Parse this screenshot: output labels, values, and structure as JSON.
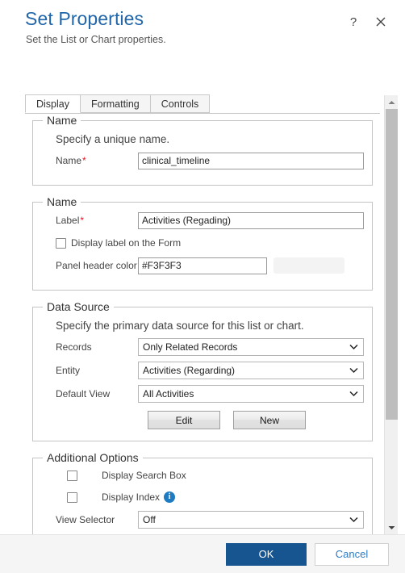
{
  "dialog": {
    "title": "Set Properties",
    "subtitle": "Set the List or Chart properties.",
    "help_icon": "help-question-icon",
    "close_icon": "close-x-icon"
  },
  "tabs": [
    {
      "label": "Display",
      "active": true
    },
    {
      "label": "Formatting",
      "active": false
    },
    {
      "label": "Controls",
      "active": false
    }
  ],
  "groups": {
    "name_group": {
      "legend": "Name",
      "description": "Specify a unique name.",
      "name_label": "Name",
      "name_required": "*",
      "name_value": "clinical_timeline"
    },
    "label_group": {
      "legend": "Name",
      "label_label": "Label",
      "label_required": "*",
      "label_value": "Activities (Regading)",
      "display_label_checkbox": "Display label on the Form",
      "display_label_checked": false,
      "panel_header_color_label": "Panel header color",
      "panel_header_color_value": "#F3F3F3",
      "panel_header_color_swatch": "#F3F3F3"
    },
    "data_source": {
      "legend": "Data Source",
      "description": "Specify the primary data source for this list or chart.",
      "records_label": "Records",
      "records_value": "Only Related Records",
      "entity_label": "Entity",
      "entity_value": "Activities (Regarding)",
      "default_view_label": "Default View",
      "default_view_value": "All Activities",
      "edit_button": "Edit",
      "new_button": "New"
    },
    "additional_options": {
      "legend": "Additional Options",
      "display_search_box_label": "Display Search Box",
      "display_search_box_checked": false,
      "display_index_label": "Display Index",
      "display_index_checked": false,
      "display_index_info_icon": "info-icon",
      "view_selector_label": "View Selector",
      "view_selector_value": "Off"
    }
  },
  "footer": {
    "ok_label": "OK",
    "cancel_label": "Cancel"
  },
  "colors": {
    "title_blue": "#2266AA",
    "primary_button": "#16558F",
    "link_blue": "#2C7CC4",
    "required_red": "#E81123",
    "info_blue": "#1F7BC1"
  },
  "scrollbar": {
    "up_arrow_icon": "chevron-up-icon",
    "down_arrow_icon": "chevron-down-icon"
  }
}
